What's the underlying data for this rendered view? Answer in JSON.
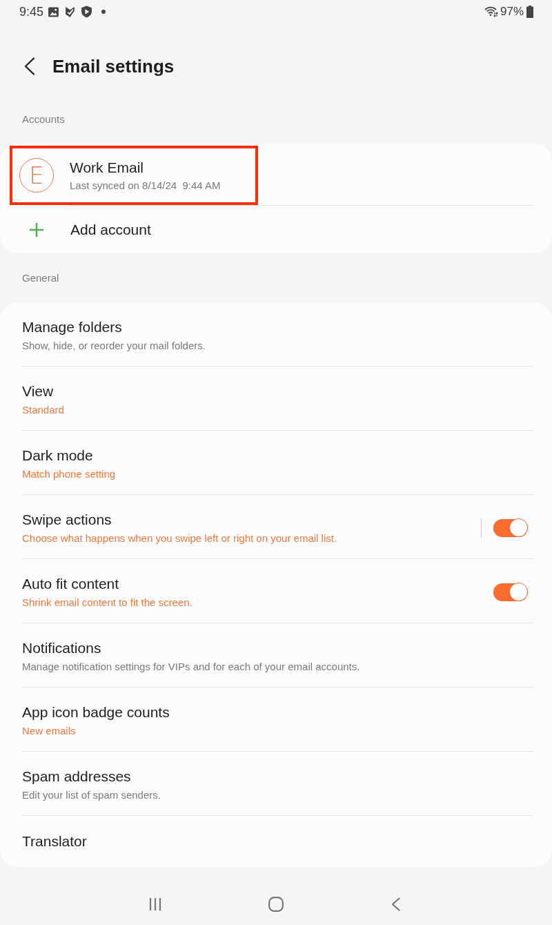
{
  "status_bar": {
    "time": "9:45",
    "battery": "97%"
  },
  "header": {
    "title": "Email settings"
  },
  "accounts": {
    "heading": "Accounts",
    "items": [
      {
        "initial": "E",
        "name": "Work Email",
        "subtitle": "Last synced on 8/14/24  9:44 AM",
        "highlighted": true
      }
    ],
    "add_label": "Add account"
  },
  "general": {
    "heading": "General",
    "items": [
      {
        "kind": "link",
        "title": "Manage folders",
        "subtitle": "Show, hide, or reorder your mail folders.",
        "accent": false
      },
      {
        "kind": "link",
        "title": "View",
        "subtitle": "Standard",
        "accent": true
      },
      {
        "kind": "link",
        "title": "Dark mode",
        "subtitle": "Match phone setting",
        "accent": true
      },
      {
        "kind": "switch",
        "title": "Swipe actions",
        "subtitle": "Choose what happens when you swipe left or right on your email list.",
        "accent": true,
        "on": true,
        "split": true
      },
      {
        "kind": "switch",
        "title": "Auto fit content",
        "subtitle": "Shrink email content to fit the screen.",
        "accent": true,
        "on": true,
        "split": false
      },
      {
        "kind": "link",
        "title": "Notifications",
        "subtitle": "Manage notification settings for VIPs and for each of your email accounts.",
        "accent": false
      },
      {
        "kind": "link",
        "title": "App icon badge counts",
        "subtitle": "New emails",
        "accent": true
      },
      {
        "kind": "link",
        "title": "Spam addresses",
        "subtitle": "Edit your list of spam senders.",
        "accent": false
      },
      {
        "kind": "link",
        "title": "Translator"
      }
    ]
  }
}
